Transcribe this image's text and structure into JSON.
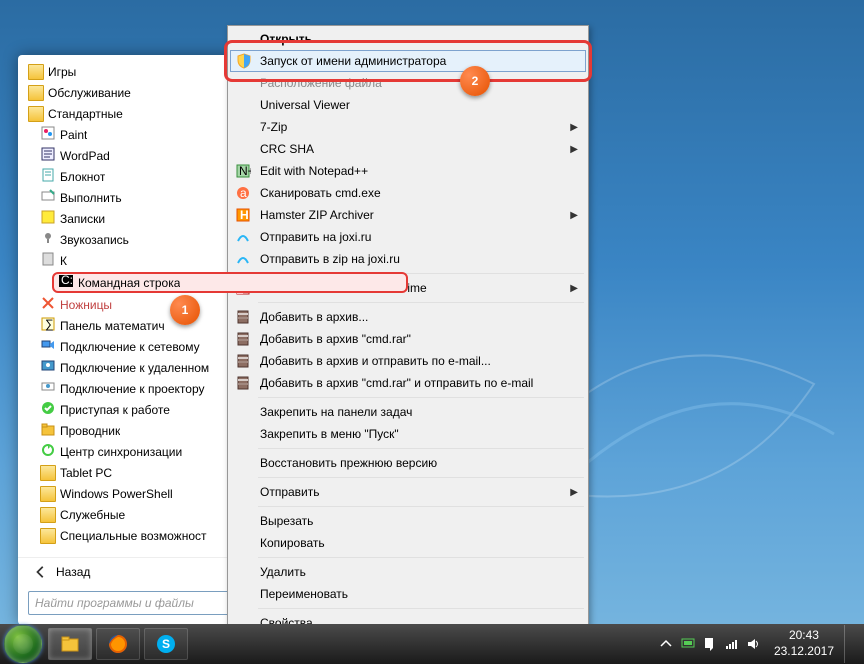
{
  "startmenu": {
    "tree": [
      {
        "label": "Игры",
        "type": "folder",
        "indent": 0
      },
      {
        "label": "Обслуживание",
        "type": "folder",
        "indent": 0
      },
      {
        "label": "Стандартные",
        "type": "folder",
        "indent": 0,
        "expanded": true
      },
      {
        "label": "Paint",
        "type": "app",
        "indent": 1,
        "icon": "paint"
      },
      {
        "label": "WordPad",
        "type": "app",
        "indent": 1,
        "icon": "wordpad"
      },
      {
        "label": "Блокнот",
        "type": "app",
        "indent": 1,
        "icon": "notepad"
      },
      {
        "label": "Выполнить",
        "type": "app",
        "indent": 1,
        "icon": "run"
      },
      {
        "label": "Записки",
        "type": "app",
        "indent": 1,
        "icon": "notes"
      },
      {
        "label": "Звукозапись",
        "type": "app",
        "indent": 1,
        "icon": "soundrec"
      },
      {
        "label": "К",
        "type": "app",
        "indent": 1,
        "icon": "calc",
        "cut": true
      },
      {
        "label": "Командная строка",
        "type": "app",
        "indent": 1,
        "icon": "cmd",
        "highlight": true
      },
      {
        "label": "Ножницы",
        "type": "app",
        "indent": 1,
        "icon": "snip",
        "cut": true,
        "redtext": true
      },
      {
        "label": "Панель математич",
        "type": "app",
        "indent": 1,
        "icon": "mathpanel",
        "cut": true
      },
      {
        "label": "Подключение к сетевому",
        "type": "app",
        "indent": 1,
        "icon": "proj",
        "cut": true
      },
      {
        "label": "Подключение к удаленном",
        "type": "app",
        "indent": 1,
        "icon": "rdp",
        "cut": true
      },
      {
        "label": "Подключение к проектору",
        "type": "app",
        "indent": 1,
        "icon": "proj2"
      },
      {
        "label": "Приступая к работе",
        "type": "app",
        "indent": 1,
        "icon": "welcome"
      },
      {
        "label": "Проводник",
        "type": "app",
        "indent": 1,
        "icon": "explorer"
      },
      {
        "label": "Центр синхронизации",
        "type": "app",
        "indent": 1,
        "icon": "sync"
      },
      {
        "label": "Tablet PC",
        "type": "folder",
        "indent": 1
      },
      {
        "label": "Windows PowerShell",
        "type": "folder",
        "indent": 1
      },
      {
        "label": "Служебные",
        "type": "folder",
        "indent": 1
      },
      {
        "label": "Специальные возможност",
        "type": "folder",
        "indent": 1,
        "cut": true
      }
    ],
    "back": "Назад",
    "search_placeholder": "Найти программы и файлы"
  },
  "contextmenu": {
    "items": [
      {
        "label": "Открыть",
        "type": "item",
        "bold": true,
        "cut": true
      },
      {
        "label": "Запуск от имени администратора",
        "type": "item",
        "icon": "shield",
        "highlight": true
      },
      {
        "label": "Расположение файла",
        "type": "item",
        "cut": true,
        "grey": true
      },
      {
        "label": "Universal Viewer",
        "type": "item"
      },
      {
        "label": "7-Zip",
        "type": "item",
        "submenu": true
      },
      {
        "label": "CRC SHA",
        "type": "item",
        "submenu": true
      },
      {
        "label": "Edit with Notepad++",
        "type": "item",
        "icon": "npp"
      },
      {
        "label": "Сканировать cmd.exe",
        "type": "item",
        "icon": "avast"
      },
      {
        "label": "Hamster ZIP Archiver",
        "type": "item",
        "icon": "hamster",
        "submenu": true
      },
      {
        "label": "Отправить на joxi.ru",
        "type": "item",
        "icon": "joxi"
      },
      {
        "label": "Отправить в zip на joxi.ru",
        "type": "item",
        "icon": "joxi"
      },
      {
        "type": "sep"
      },
      {
        "label": "Total Commander Ultima Prime",
        "type": "item",
        "icon": "tc",
        "submenu": true
      },
      {
        "type": "sep"
      },
      {
        "label": "Добавить в архив...",
        "type": "item",
        "icon": "rar"
      },
      {
        "label": "Добавить в архив \"cmd.rar\"",
        "type": "item",
        "icon": "rar"
      },
      {
        "label": "Добавить в архив и отправить по e-mail...",
        "type": "item",
        "icon": "rar"
      },
      {
        "label": "Добавить в архив \"cmd.rar\" и отправить по e-mail",
        "type": "item",
        "icon": "rar"
      },
      {
        "type": "sep"
      },
      {
        "label": "Закрепить на панели задач",
        "type": "item"
      },
      {
        "label": "Закрепить в меню \"Пуск\"",
        "type": "item"
      },
      {
        "type": "sep"
      },
      {
        "label": "Восстановить прежнюю версию",
        "type": "item"
      },
      {
        "type": "sep"
      },
      {
        "label": "Отправить",
        "type": "item",
        "submenu": true
      },
      {
        "type": "sep"
      },
      {
        "label": "Вырезать",
        "type": "item"
      },
      {
        "label": "Копировать",
        "type": "item"
      },
      {
        "type": "sep"
      },
      {
        "label": "Удалить",
        "type": "item"
      },
      {
        "label": "Переименовать",
        "type": "item"
      },
      {
        "type": "sep"
      },
      {
        "label": "Свойства",
        "type": "item"
      }
    ]
  },
  "taskbar": {
    "time": "20:43",
    "date": "23.12.2017"
  },
  "badges": {
    "one": "1",
    "two": "2"
  }
}
